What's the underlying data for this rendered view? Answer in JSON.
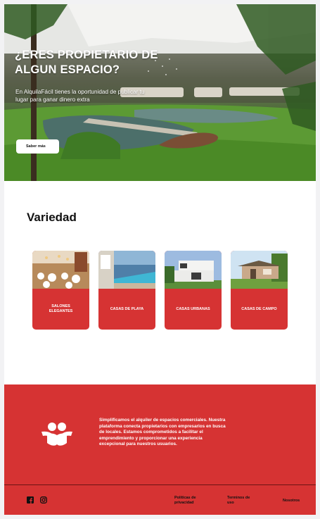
{
  "hero": {
    "title": "¿ERES PROPIETARIO DE ALGUN ESPACIO?",
    "subtitle": "En AlquilaFácil tienes la oportunidad de publicar tu lugar para ganar dinero extra",
    "button_label": "Saber más"
  },
  "variety": {
    "title": "Variedad",
    "cards": [
      {
        "label": "SALONES ELEGANTES"
      },
      {
        "label": "CASAS DE PLAYA"
      },
      {
        "label": "CASAS URBANAS"
      },
      {
        "label": "CASAS DE CAMPO"
      }
    ]
  },
  "about": {
    "text": "Simplificamos el alquiler de espacios comerciales. Nuestra plataforma conecta propietarios con empresarios en busca de locales. Estamos comprometidos a facilitar el emprendimiento y proporcionar una experiencia excepcional para nuestros usuarios.",
    "logo_icon": "handshake-people-icon"
  },
  "footer": {
    "social": [
      "facebook-icon",
      "instagram-icon"
    ],
    "links": {
      "privacy": "Políticas de privacidad",
      "terms": "Terminos de uso",
      "about": "Nosotros"
    }
  },
  "colors": {
    "brand_red": "#d63333",
    "white": "#ffffff",
    "text_dark": "#111111"
  }
}
